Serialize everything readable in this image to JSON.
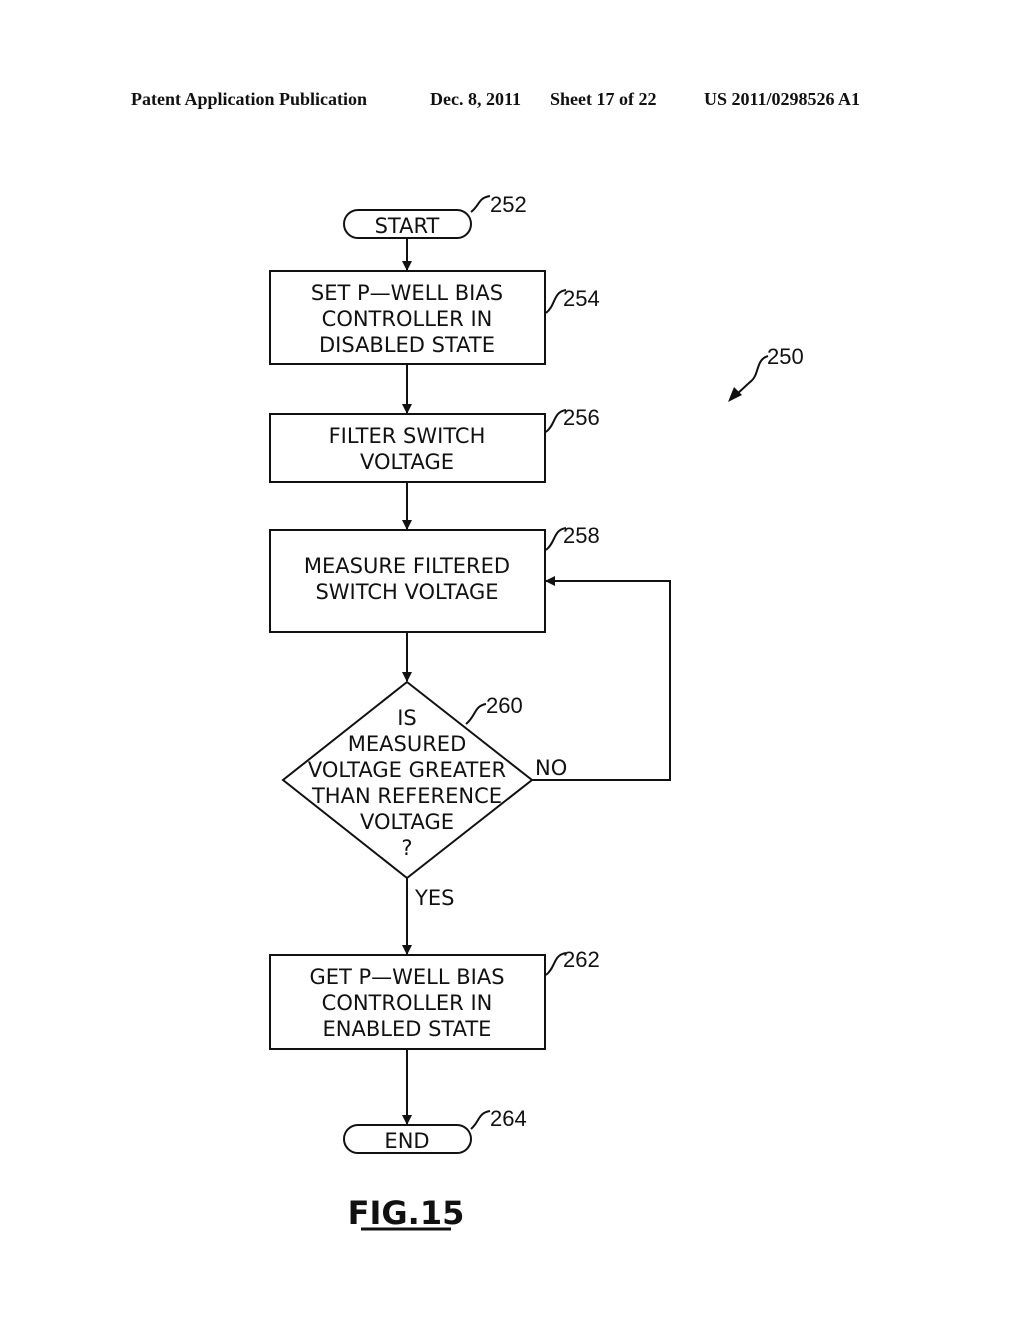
{
  "header": {
    "publication": "Patent Application Publication",
    "date": "Dec. 8, 2011",
    "sheet": "Sheet 17 of 22",
    "number": "US 2011/0298526 A1"
  },
  "diagram": {
    "figure_label": "FIG.15",
    "overall_ref": "250",
    "nodes": {
      "start": {
        "ref": "252",
        "lines": [
          "START"
        ]
      },
      "set_disabled": {
        "ref": "254",
        "lines": [
          "SET  P—WELL  BIAS",
          "CONTROLLER  IN",
          "DISABLED  STATE"
        ]
      },
      "filter": {
        "ref": "256",
        "lines": [
          "FILTER  SWITCH",
          "VOLTAGE"
        ]
      },
      "measure": {
        "ref": "258",
        "lines": [
          "MEASURE  FILTERED",
          "SWITCH  VOLTAGE"
        ]
      },
      "decision": {
        "ref": "260",
        "lines": [
          "IS",
          "MEASURED",
          "VOLTAGE  GREATER",
          "THAN  REFERENCE",
          "VOLTAGE",
          "?"
        ]
      },
      "set_enabled": {
        "ref": "262",
        "lines": [
          "GET  P—WELL  BIAS",
          "CONTROLLER  IN",
          "ENABLED  STATE"
        ]
      },
      "end": {
        "ref": "264",
        "lines": [
          "END"
        ]
      }
    },
    "edge_labels": {
      "no": "NO",
      "yes": "YES"
    }
  }
}
